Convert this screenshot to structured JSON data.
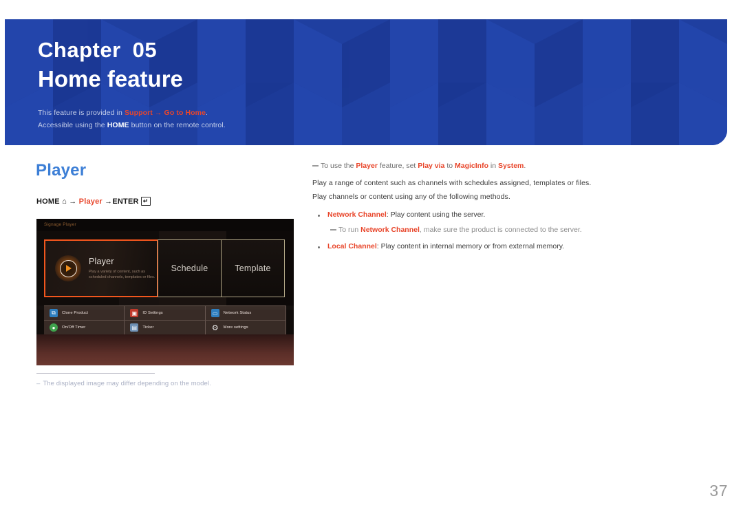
{
  "banner": {
    "chapter_label": "Chapter",
    "chapter_number": "05",
    "title": "Home feature",
    "note1_prefix": "This feature is provided in ",
    "note1_support": "Support",
    "note1_arrow": " → ",
    "note1_gotohome": "Go to Home",
    "note1_suffix": ".",
    "note2_prefix": "Accessible using the ",
    "note2_home": "HOME",
    "note2_suffix": " button on the remote control."
  },
  "section": {
    "title": "Player"
  },
  "breadcrumb": {
    "home": "HOME",
    "home_icon": "home-icon",
    "arrow1": "→",
    "player": "Player",
    "arrow2": "→",
    "enter": "ENTER",
    "enter_key_icon": "enter-key-icon"
  },
  "screenshot": {
    "header_label": "Signage Player",
    "tiles": [
      {
        "name": "player",
        "title": "Player",
        "desc": "Play a variety of content, such as scheduled channels, templates or files.",
        "icon": "play-circle-icon",
        "selected": true
      },
      {
        "name": "schedule",
        "title": "Schedule",
        "desc": "",
        "icon": "",
        "selected": false
      },
      {
        "name": "template",
        "title": "Template",
        "desc": "",
        "icon": "",
        "selected": false
      }
    ],
    "mini_tiles": [
      {
        "label": "Clone Product",
        "icon": "clone-product-icon",
        "glyph": "⧉",
        "color": "#2f7fbf"
      },
      {
        "label": "ID Settings",
        "icon": "id-settings-icon",
        "glyph": "▣",
        "color": "#c0392b"
      },
      {
        "label": "Network Status",
        "icon": "network-status-icon",
        "glyph": "▭",
        "color": "#2f7fbf"
      },
      {
        "label": "On/Off Timer",
        "icon": "on-off-timer-icon",
        "glyph": "●",
        "color": "#3fa34d"
      },
      {
        "label": "Ticker",
        "icon": "ticker-icon",
        "glyph": "▤",
        "color": "#6d8fb3"
      },
      {
        "label": "More settings",
        "icon": "more-settings-gear-icon",
        "glyph": "⚙",
        "color": "#e8e8e8"
      }
    ]
  },
  "screenshot_footnote": {
    "dash": "–",
    "text": "The displayed image may differ depending on the model."
  },
  "content": {
    "note_top": {
      "pre": "To use the ",
      "a1": "Player",
      "mid1": " feature, set ",
      "a2": "Play via",
      "mid2": " to ",
      "a3": "MagicInfo",
      "mid3": " in ",
      "a4": "System",
      "post": "."
    },
    "paragraph1": "Play a range of content such as channels with schedules assigned, templates or files.",
    "paragraph2": "Play channels or content using any of the following methods.",
    "bullet1": {
      "accent": "Network Channel",
      "rest": ": Play content using the server."
    },
    "subnote1": {
      "pre": "To run ",
      "accent": "Network Channel",
      "post": ", make sure the product is connected to the server."
    },
    "bullet2": {
      "accent": "Local Channel",
      "rest": ": Play content in internal memory or from external memory."
    }
  },
  "page_number": "37",
  "colors": {
    "banner_blue": "#1f3fa0",
    "accent_red": "#e8462b",
    "section_blue": "#3d7fd6",
    "tile_highlight_orange": "#f2561d"
  }
}
